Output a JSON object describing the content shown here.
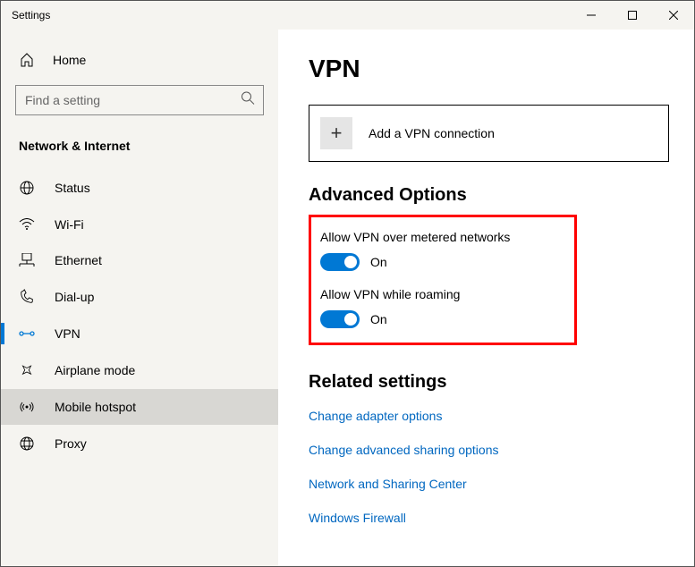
{
  "window": {
    "title": "Settings"
  },
  "sidebar": {
    "home": "Home",
    "search_placeholder": "Find a setting",
    "section": "Network & Internet",
    "items": [
      {
        "label": "Status"
      },
      {
        "label": "Wi-Fi"
      },
      {
        "label": "Ethernet"
      },
      {
        "label": "Dial-up"
      },
      {
        "label": "VPN"
      },
      {
        "label": "Airplane mode"
      },
      {
        "label": "Mobile hotspot"
      },
      {
        "label": "Proxy"
      }
    ]
  },
  "main": {
    "title": "VPN",
    "add_button": "Add a VPN connection",
    "advanced_title": "Advanced Options",
    "toggle1_label": "Allow VPN over metered networks",
    "toggle1_state": "On",
    "toggle2_label": "Allow VPN while roaming",
    "toggle2_state": "On",
    "related_title": "Related settings",
    "links": {
      "l1": "Change adapter options",
      "l2": "Change advanced sharing options",
      "l3": "Network and Sharing Center",
      "l4": "Windows Firewall"
    }
  }
}
